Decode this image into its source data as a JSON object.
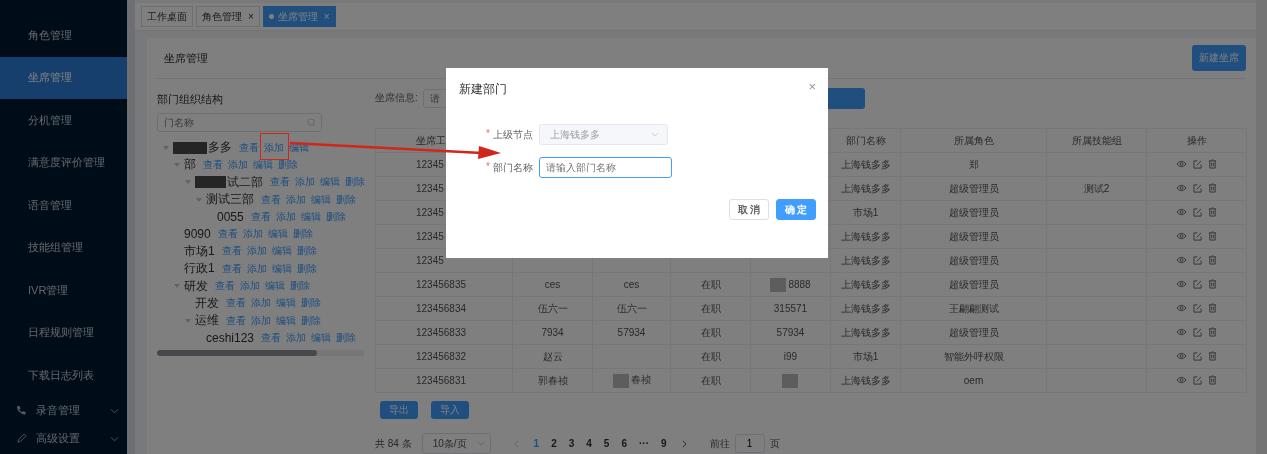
{
  "sidebar": {
    "items": [
      {
        "label": "角色管理",
        "selected": false
      },
      {
        "label": "坐席管理",
        "selected": true
      },
      {
        "label": "分机管理",
        "selected": false
      },
      {
        "label": "满意度评价管理",
        "selected": false
      },
      {
        "label": "语音管理",
        "selected": false
      },
      {
        "label": "技能组管理",
        "selected": false
      },
      {
        "label": "IVR管理",
        "selected": false
      },
      {
        "label": "日程规则管理",
        "selected": false
      },
      {
        "label": "下载日志列表",
        "selected": false
      },
      {
        "label": "录音管理",
        "selected": false,
        "kind": "phone",
        "expandable": true
      },
      {
        "label": "高级设置",
        "selected": false,
        "kind": "pen",
        "expandable": true
      }
    ]
  },
  "tabs": [
    {
      "label": "工作桌面",
      "selected": false
    },
    {
      "label": "角色管理",
      "selected": false,
      "close": "×"
    },
    {
      "label": "坐席管理",
      "selected": true,
      "close": "×"
    }
  ],
  "page": {
    "title": "坐席管理",
    "new_button": "新建坐席"
  },
  "tree": {
    "title": "部门组织结构",
    "search": {
      "placeholder": "门名称"
    },
    "nodes": [
      {
        "label": "多多",
        "redacted": true,
        "expanded": true,
        "actions": [
          "查看",
          "添加",
          "编辑"
        ],
        "children": [
          {
            "label": "部",
            "expanded": true,
            "actions": [
              "查看",
              "添加",
              "编辑",
              "删除"
            ],
            "children": [
              {
                "label": "试二部",
                "redacted": true,
                "expanded": true,
                "actions": [
                  "查看",
                  "添加",
                  "编辑",
                  "删除"
                ],
                "children": [
                  {
                    "label": "测试三部",
                    "expanded": true,
                    "actions": [
                      "查看",
                      "添加",
                      "编辑",
                      "删除"
                    ],
                    "children": [
                      {
                        "label": "0055",
                        "actions": [
                          "查看",
                          "添加",
                          "编辑",
                          "删除"
                        ]
                      }
                    ]
                  }
                ]
              }
            ]
          },
          {
            "label": "9090",
            "actions": [
              "查看",
              "添加",
              "编辑",
              "删除"
            ]
          },
          {
            "label": "市场1",
            "actions": [
              "查看",
              "添加",
              "编辑",
              "删除"
            ]
          },
          {
            "label": "行政1",
            "actions": [
              "查看",
              "添加",
              "编辑",
              "删除"
            ]
          },
          {
            "label": "研发",
            "expanded": true,
            "actions": [
              "查看",
              "添加",
              "编辑",
              "删除"
            ],
            "children": [
              {
                "label": "开发",
                "actions": [
                  "查看",
                  "添加",
                  "编辑",
                  "删除"
                ]
              },
              {
                "label": "运维",
                "expanded": true,
                "actions": [
                  "查看",
                  "添加",
                  "编辑",
                  "删除"
                ],
                "children": [
                  {
                    "label": "ceshi123",
                    "actions": [
                      "查看",
                      "添加",
                      "编辑",
                      "删除"
                    ]
                  }
                ]
              }
            ]
          }
        ]
      }
    ]
  },
  "filter": {
    "label": "坐席信息:",
    "placeholder": "请"
  },
  "table": {
    "columns": [
      "坐席工",
      "",
      "",
      "",
      "",
      "部门名称",
      "所属角色",
      "所属技能组",
      "操作"
    ],
    "rows": [
      {
        "cells": [
          "12345",
          "",
          "",
          "",
          "",
          "上海钱多多",
          "郑",
          ""
        ]
      },
      {
        "cells": [
          "12345",
          "",
          "",
          "",
          "",
          "上海钱多多",
          "超级管理员",
          "测试2"
        ]
      },
      {
        "cells": [
          "12345",
          "",
          "",
          "",
          "",
          "市场1",
          "超级管理员",
          ""
        ]
      },
      {
        "cells": [
          "12345",
          "",
          "",
          "",
          "",
          "上海钱多多",
          "超级管理员",
          ""
        ]
      },
      {
        "cells": [
          "12345",
          "",
          "",
          "",
          "",
          "上海钱多多",
          "超级管理员",
          ""
        ]
      },
      {
        "cells": [
          "123456835",
          "ces",
          "ces",
          "在职",
          {
            "text": "8888",
            "redacted": true
          },
          "上海钱多多",
          "超级管理员",
          ""
        ]
      },
      {
        "cells": [
          "123456834",
          "伍六一",
          "伍六一",
          "在职",
          "315571",
          "上海钱多多",
          "王翩翩测试",
          ""
        ]
      },
      {
        "cells": [
          "123456833",
          "7934",
          "57934",
          "在职",
          "57934",
          "上海钱多多",
          "超级管理员",
          ""
        ]
      },
      {
        "cells": [
          "123456832",
          "赵云",
          "",
          "在职",
          "i99",
          "市场1",
          "智能外呼权限",
          ""
        ]
      },
      {
        "cells": [
          "123456831",
          "郭春祯",
          {
            "text": "春祯",
            "redacted": true
          },
          "在职",
          {
            "text": "",
            "redacted": true
          },
          "上海钱多多",
          "oem",
          ""
        ]
      }
    ]
  },
  "actions": [
    "导出",
    "导入"
  ],
  "pagination": {
    "total": "共 84 条",
    "page_size": "10条/页",
    "pages": [
      {
        "label": "1",
        "selected": true
      },
      {
        "label": "2",
        "selected": false
      },
      {
        "label": "3",
        "selected": false
      },
      {
        "label": "4",
        "selected": false
      },
      {
        "label": "5",
        "selected": false
      },
      {
        "label": "6",
        "selected": false
      },
      {
        "label": "···",
        "selected": false
      },
      {
        "label": "9",
        "selected": false
      }
    ],
    "goto_label": "前往",
    "goto_value": "1",
    "goto_suffix": "页"
  },
  "dialog": {
    "title": "新建部门",
    "close": "×",
    "fields": [
      {
        "label": "上级节点",
        "required_mark": "*",
        "kind": "select",
        "value": "上海钱多多",
        "disabled": true
      },
      {
        "label": "部门名称",
        "required_mark": "*",
        "kind": "input",
        "placeholder": "请输入部门名称",
        "disabled": false
      }
    ],
    "buttons": [
      {
        "label": "取 消",
        "kind": "default"
      },
      {
        "label": "确 定",
        "kind": "primary"
      }
    ]
  }
}
